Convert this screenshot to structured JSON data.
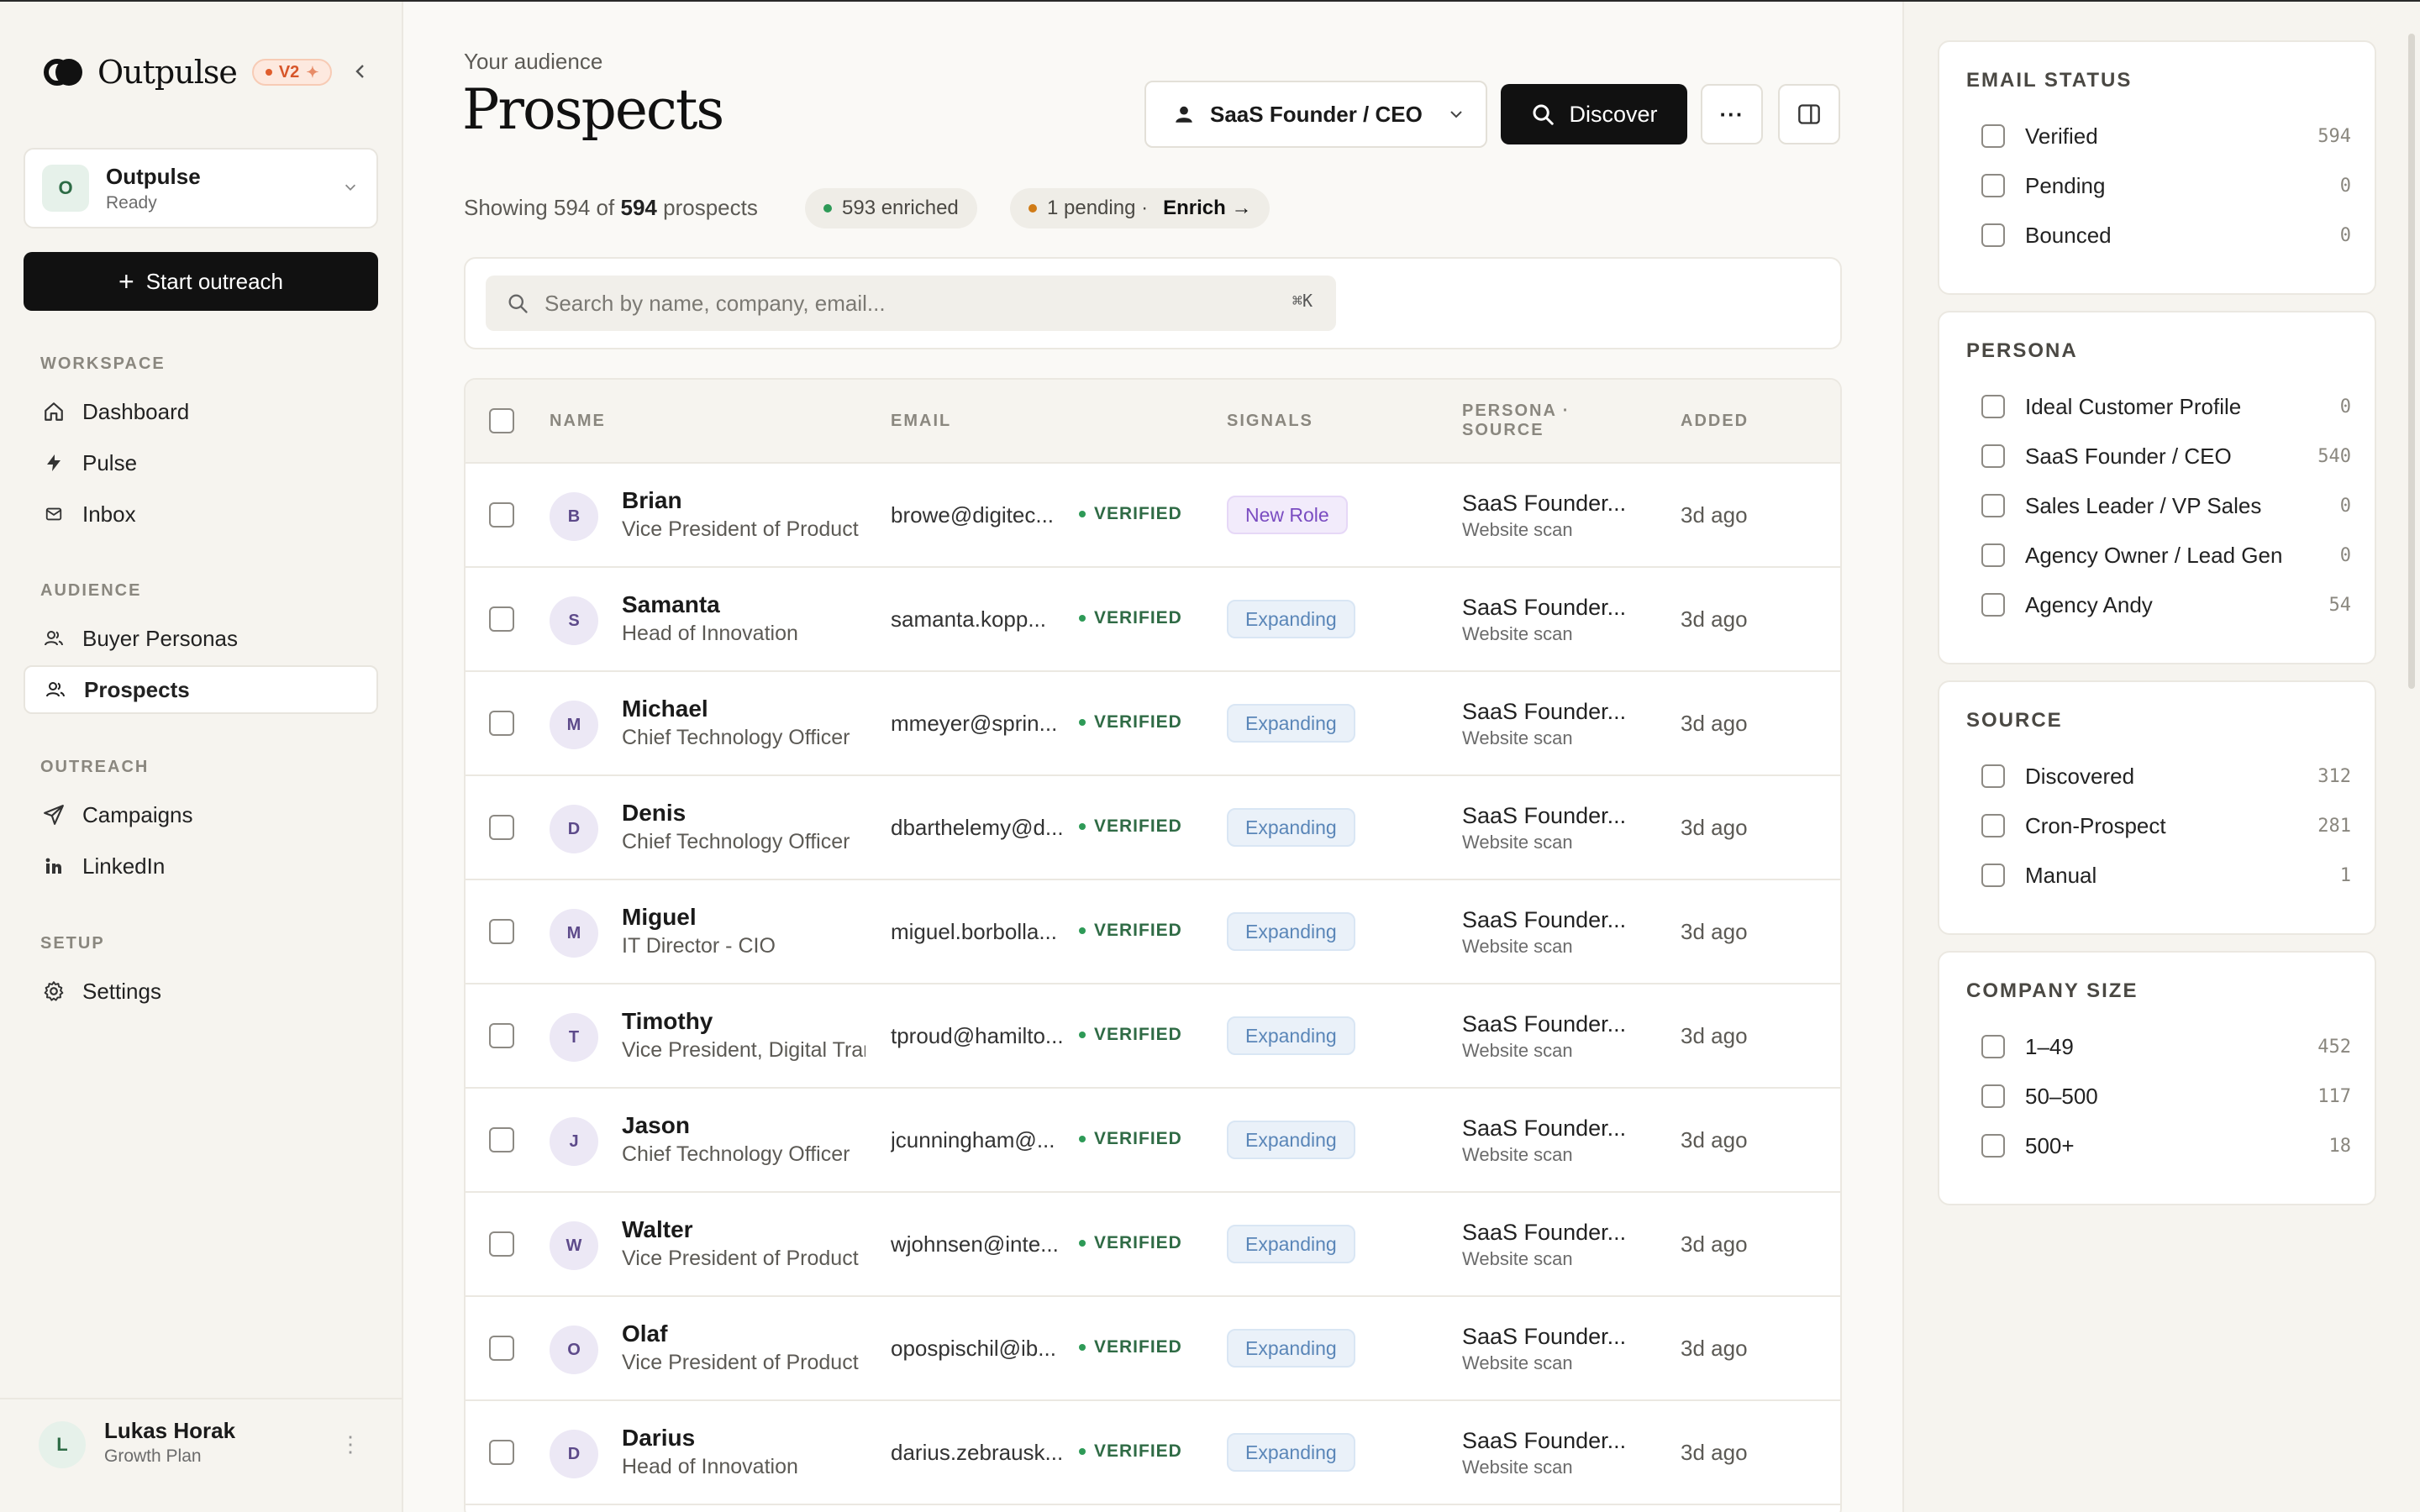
{
  "app": {
    "name": "Outpulse",
    "version_badge": "V2"
  },
  "workspace": {
    "avatar": "O",
    "name": "Outpulse",
    "status": "Ready"
  },
  "sidebar": {
    "cta": "Start outreach",
    "sections": {
      "workspace": "WORKSPACE",
      "audience": "AUDIENCE",
      "outreach": "OUTREACH",
      "setup": "SETUP"
    },
    "items": {
      "dashboard": "Dashboard",
      "pulse": "Pulse",
      "inbox": "Inbox",
      "buyer_personas": "Buyer Personas",
      "prospects": "Prospects",
      "campaigns": "Campaigns",
      "linkedin": "LinkedIn",
      "settings": "Settings"
    }
  },
  "user": {
    "avatar": "L",
    "name": "Lukas Horak",
    "plan": "Growth Plan"
  },
  "header": {
    "eyebrow": "Your audience",
    "title": "Prospects",
    "persona_select": "SaaS Founder / CEO",
    "discover_label": "Discover",
    "more_label": "···"
  },
  "summary": {
    "prefix": "Showing 594 of",
    "total": "594",
    "suffix": "prospects",
    "enriched": "593 enriched",
    "pending": "1 pending ·",
    "enrich_link": "Enrich →"
  },
  "search": {
    "placeholder": "Search by name, company, email...",
    "shortcut": "⌘K"
  },
  "table": {
    "columns": {
      "name": "NAME",
      "email": "EMAIL",
      "signals": "SIGNALS",
      "persona_source_1": "PERSONA ·",
      "persona_source_2": "SOURCE",
      "added": "ADDED"
    },
    "rows": [
      {
        "initial": "B",
        "name": "Brian",
        "title": "Vice President of Product",
        "email": "browe@digitec...",
        "status": "VERIFIED",
        "signal": "New Role",
        "signal_kind": "newrole",
        "persona": "SaaS Founder...",
        "source": "Website scan",
        "added": "3d ago"
      },
      {
        "initial": "S",
        "name": "Samanta",
        "title": "Head of Innovation",
        "email": "samanta.kopp...",
        "status": "VERIFIED",
        "signal": "Expanding",
        "signal_kind": "expanding",
        "persona": "SaaS Founder...",
        "source": "Website scan",
        "added": "3d ago"
      },
      {
        "initial": "M",
        "name": "Michael",
        "title": "Chief Technology Officer",
        "email": "mmeyer@sprin...",
        "status": "VERIFIED",
        "signal": "Expanding",
        "signal_kind": "expanding",
        "persona": "SaaS Founder...",
        "source": "Website scan",
        "added": "3d ago"
      },
      {
        "initial": "D",
        "name": "Denis",
        "title": "Chief Technology Officer",
        "email": "dbarthelemy@d...",
        "status": "VERIFIED",
        "signal": "Expanding",
        "signal_kind": "expanding",
        "persona": "SaaS Founder...",
        "source": "Website scan",
        "added": "3d ago"
      },
      {
        "initial": "M",
        "name": "Miguel",
        "title": "IT Director - CIO",
        "email": "miguel.borbolla...",
        "status": "VERIFIED",
        "signal": "Expanding",
        "signal_kind": "expanding",
        "persona": "SaaS Founder...",
        "source": "Website scan",
        "added": "3d ago"
      },
      {
        "initial": "T",
        "name": "Timothy",
        "title": "Vice President, Digital Transformation",
        "email": "tproud@hamilto...",
        "status": "VERIFIED",
        "signal": "Expanding",
        "signal_kind": "expanding",
        "persona": "SaaS Founder...",
        "source": "Website scan",
        "added": "3d ago"
      },
      {
        "initial": "J",
        "name": "Jason",
        "title": "Chief Technology Officer",
        "email": "jcunningham@...",
        "status": "VERIFIED",
        "signal": "Expanding",
        "signal_kind": "expanding",
        "persona": "SaaS Founder...",
        "source": "Website scan",
        "added": "3d ago"
      },
      {
        "initial": "W",
        "name": "Walter",
        "title": "Vice President of Product",
        "email": "wjohnsen@inte...",
        "status": "VERIFIED",
        "signal": "Expanding",
        "signal_kind": "expanding",
        "persona": "SaaS Founder...",
        "source": "Website scan",
        "added": "3d ago"
      },
      {
        "initial": "O",
        "name": "Olaf",
        "title": "Vice President of Product",
        "email": "opospischil@ib...",
        "status": "VERIFIED",
        "signal": "Expanding",
        "signal_kind": "expanding",
        "persona": "SaaS Founder...",
        "source": "Website scan",
        "added": "3d ago"
      },
      {
        "initial": "D",
        "name": "Darius",
        "title": "Head of Innovation",
        "email": "darius.zebrausk...",
        "status": "VERIFIED",
        "signal": "Expanding",
        "signal_kind": "expanding",
        "persona": "SaaS Founder...",
        "source": "Website scan",
        "added": "3d ago"
      }
    ]
  },
  "filters": [
    {
      "key": "email-status",
      "title": "EMAIL STATUS",
      "options": [
        {
          "label": "Verified",
          "count": "594"
        },
        {
          "label": "Pending",
          "count": "0"
        },
        {
          "label": "Bounced",
          "count": "0"
        }
      ]
    },
    {
      "key": "persona",
      "title": "PERSONA",
      "options": [
        {
          "label": "Ideal Customer Profile",
          "count": "0"
        },
        {
          "label": "SaaS Founder / CEO",
          "count": "540"
        },
        {
          "label": "Sales Leader / VP Sales",
          "count": "0"
        },
        {
          "label": "Agency Owner / Lead Gen",
          "count": "0"
        },
        {
          "label": "Agency Andy",
          "count": "54"
        }
      ]
    },
    {
      "key": "source",
      "title": "SOURCE",
      "options": [
        {
          "label": "Discovered",
          "count": "312"
        },
        {
          "label": "Cron-Prospect",
          "count": "281"
        },
        {
          "label": "Manual",
          "count": "1"
        }
      ]
    },
    {
      "key": "company-size",
      "title": "COMPANY SIZE",
      "options": [
        {
          "label": "1–49",
          "count": "452"
        },
        {
          "label": "50–500",
          "count": "117"
        },
        {
          "label": "500+",
          "count": "18"
        }
      ]
    }
  ]
}
